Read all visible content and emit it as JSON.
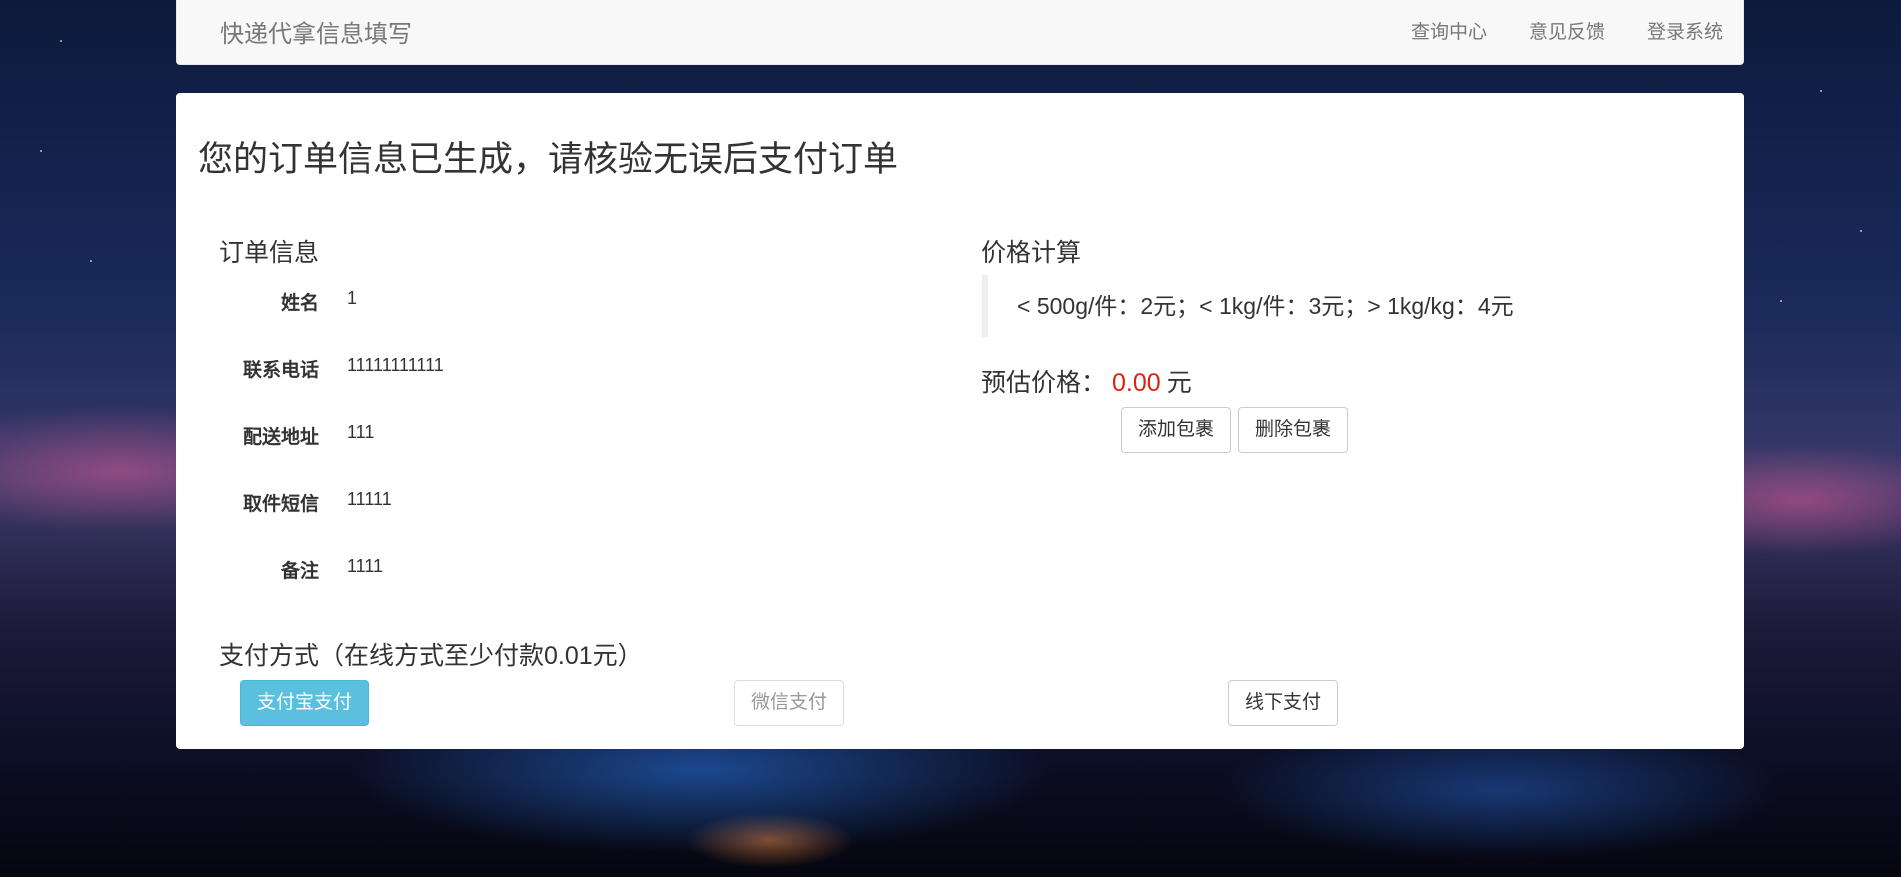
{
  "navbar": {
    "brand": "快递代拿信息填写",
    "links": [
      "查询中心",
      "意见反馈",
      "登录系统"
    ]
  },
  "heading": "您的订单信息已生成，请核验无误后支付订单",
  "order": {
    "title": "订单信息",
    "fields": [
      {
        "label": "姓名",
        "value": "1"
      },
      {
        "label": "联系电话",
        "value": "11111111111"
      },
      {
        "label": "配送地址",
        "value": "111"
      },
      {
        "label": "取件短信",
        "value": "11111"
      },
      {
        "label": "备注",
        "value": "1111"
      }
    ]
  },
  "pricing": {
    "title": "价格计算",
    "quote": "< 500g/件：2元；< 1kg/件：3元；> 1kg/kg：4元",
    "estimate_label": "预估价格：",
    "estimate_value": "0.00",
    "estimate_unit": "元",
    "add_label": "添加包裹",
    "remove_label": "删除包裹"
  },
  "payment": {
    "title": "支付方式（在线方式至少付款0.01元）",
    "alipay_label": "支付宝支付",
    "wechat_label": "微信支付",
    "offline_label": "线下支付"
  },
  "colors": {
    "accent": "#5bc0de",
    "price": "#d9230f"
  }
}
